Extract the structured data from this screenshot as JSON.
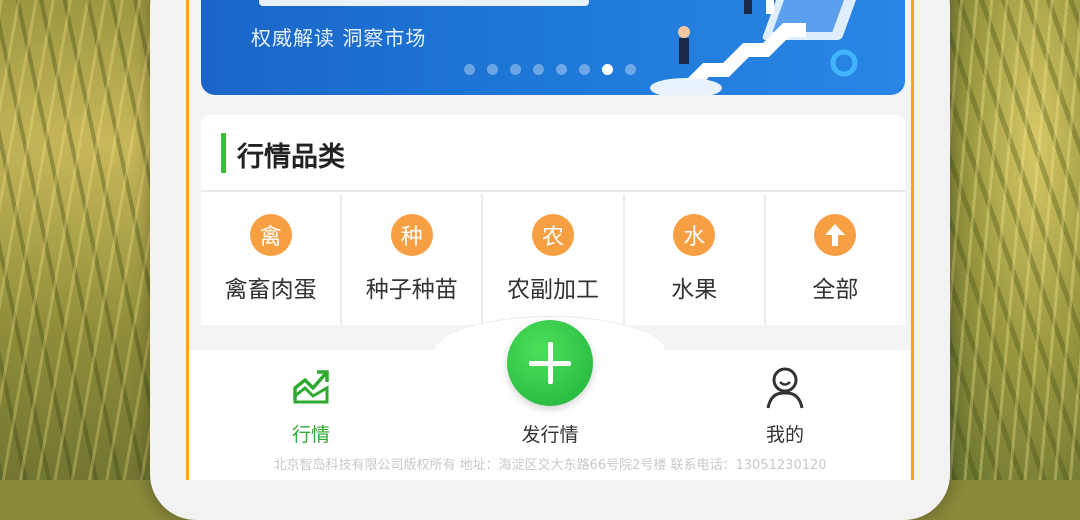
{
  "banner": {
    "subtitle": "权威解读  洞察市场",
    "slide_count": 8,
    "active_slide": 7
  },
  "section": {
    "title": "行情品类"
  },
  "categories": [
    {
      "icon_char": "禽",
      "label": "禽畜肉蛋"
    },
    {
      "icon_char": "种",
      "label": "种子种苗"
    },
    {
      "icon_char": "农",
      "label": "农副加工"
    },
    {
      "icon_char": "水",
      "label": "水果"
    },
    {
      "icon_char": "up-arrow-icon",
      "label": "全部"
    }
  ],
  "tabbar": {
    "market_label": "行情",
    "publish_label": "发行情",
    "me_label": "我的"
  },
  "footer": {
    "text": "北京智岛科技有限公司版权所有 地址：海淀区交大东路66号院2号楼 联系电话：13051230120"
  },
  "colors": {
    "accent_green": "#2eaa2e",
    "category_orange": "#f7a043",
    "banner_blue": "#1e78d8",
    "frame_orange": "#f3a81c"
  }
}
